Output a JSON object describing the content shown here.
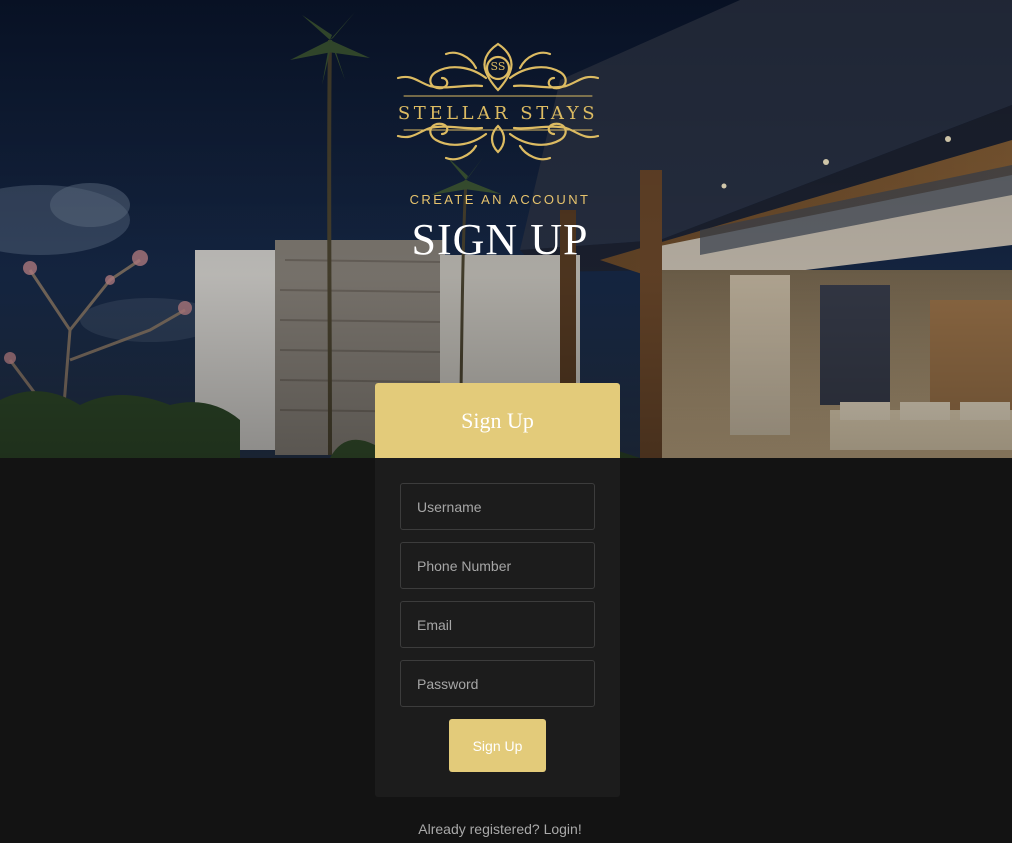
{
  "brand": {
    "name": "STELLAR STAYS",
    "monogram": "SS",
    "gold": "#dcbb62"
  },
  "hero": {
    "eyebrow": "CREATE AN ACCOUNT",
    "title": "SIGN UP"
  },
  "form": {
    "header": "Sign Up",
    "fields": {
      "username": {
        "placeholder": "Username",
        "value": ""
      },
      "phone": {
        "placeholder": "Phone Number",
        "value": ""
      },
      "email": {
        "placeholder": "Email",
        "value": ""
      },
      "password": {
        "placeholder": "Password",
        "value": ""
      }
    },
    "submit_label": "Sign Up",
    "accent": "#e3cb7a"
  },
  "footer": {
    "login_text": "Already registered? Login!"
  }
}
